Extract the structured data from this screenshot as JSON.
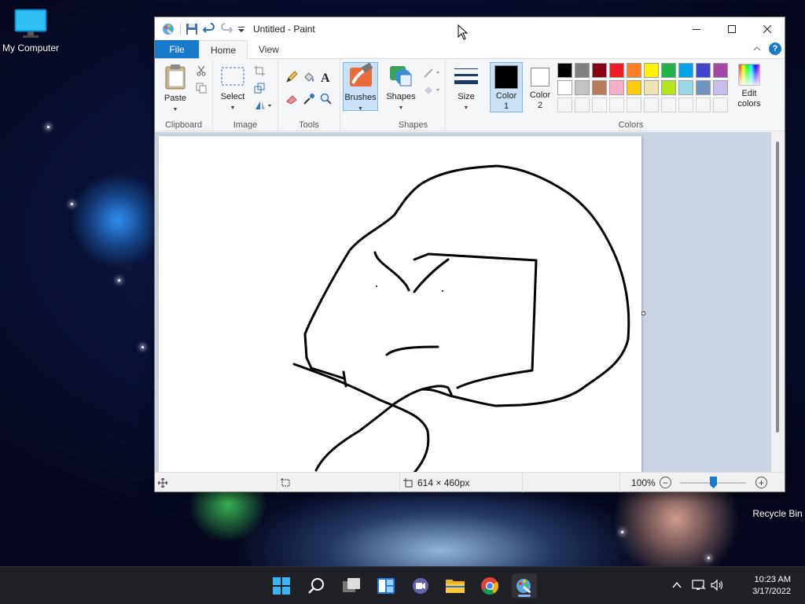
{
  "desktop": {
    "icons": [
      {
        "label": "My Computer"
      },
      {
        "label": "Recycle Bin"
      }
    ]
  },
  "window": {
    "title": "Untitled - Paint",
    "tabs": {
      "file": "File",
      "home": "Home",
      "view": "View"
    },
    "groups": {
      "clipboard": "Clipboard",
      "image": "Image",
      "tools": "Tools",
      "shapes": "Shapes",
      "colors": "Colors"
    },
    "buttons": {
      "paste": "Paste",
      "select": "Select",
      "brushes": "Brushes",
      "shapes": "Shapes",
      "size": "Size",
      "color1_line1": "Color",
      "color1_line2": "1",
      "color2_line1": "Color",
      "color2_line2": "2",
      "edit_colors_line1": "Edit",
      "edit_colors_line2": "colors"
    },
    "palette_row1": [
      "#000000",
      "#7f7f7f",
      "#880015",
      "#ed1c24",
      "#ff7f27",
      "#fff200",
      "#22b14c",
      "#00a2e8",
      "#3f48cc",
      "#a349a4"
    ],
    "palette_row2": [
      "#ffffff",
      "#c3c3c3",
      "#b97a57",
      "#ffaec9",
      "#ffc90e",
      "#efe4b0",
      "#b5e61d",
      "#99d9ea",
      "#7092be",
      "#c8bfe7"
    ],
    "color1": "#000000",
    "color2": "#ffffff",
    "accent": "#1979ca"
  },
  "status": {
    "image_size": "614 × 460px",
    "zoom": "100%",
    "zoom_level_fraction": 0.5
  },
  "taskbar": {
    "time": "10:23 AM",
    "date": "3/17/2022"
  }
}
